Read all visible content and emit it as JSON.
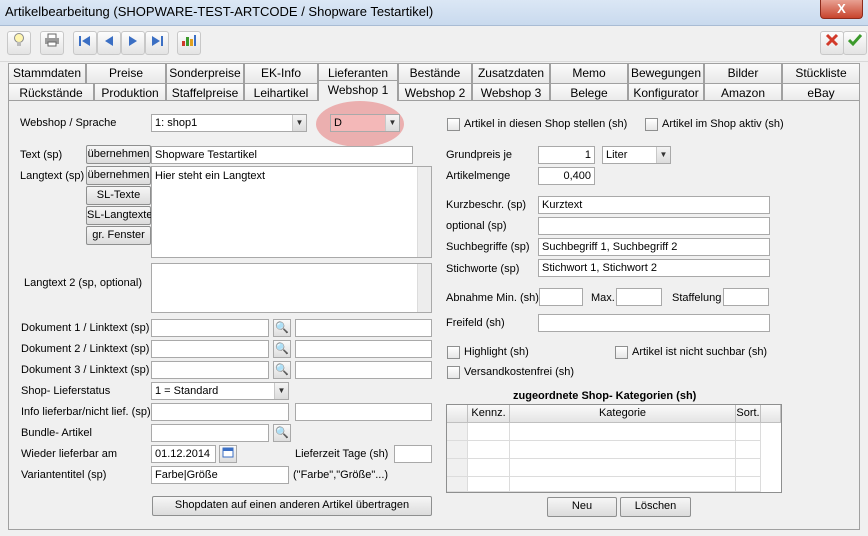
{
  "window": {
    "title": "Artikelbearbeitung (SHOPWARE-TEST-ARTCODE / Shopware Testartikel)",
    "close": "X"
  },
  "toolbar": {
    "icons": [
      "lightbulb-icon",
      "print-icon",
      "first-icon",
      "prev-icon",
      "next-icon",
      "last-icon",
      "chart-icon",
      "cancel-icon",
      "save-check-icon"
    ]
  },
  "tabs_row1": [
    "Stammdaten",
    "Preise",
    "Sonderpreise",
    "EK-Info",
    "Lieferanten",
    "Bestände",
    "Zusatzdaten",
    "Memo",
    "Bewegungen",
    "Bilder",
    "Stückliste"
  ],
  "tabs_row2": [
    "Rückstände",
    "Produktion",
    "Staffelpreise",
    "Leihartikel",
    "Webshop 1",
    "Webshop 2",
    "Webshop 3",
    "Belege",
    "Konfigurator",
    "Amazon",
    "eBay"
  ],
  "active_tab": "Webshop 1",
  "form": {
    "webshop_label": "Webshop / Sprache",
    "webshop_value": "1: shop1",
    "language_value": "D",
    "text_label": "Text (sp)",
    "uebernehmen": "übernehmen",
    "text_value": "Shopware Testartikel",
    "langtext_label": "Langtext (sp)",
    "langtext_value": "Hier steht ein Langtext",
    "sl_texte": "SL-Texte",
    "sl_langtexte": "SL-Langtexte",
    "gr_fenster": "gr. Fenster",
    "langtext2_label": "Langtext 2 (sp, optional)",
    "dok1_label": "Dokument 1 / Linktext (sp)",
    "dok2_label": "Dokument 2 / Linktext (sp)",
    "dok3_label": "Dokument 3 / Linktext (sp)",
    "lieferstatus_label": "Shop- Lieferstatus",
    "lieferstatus_value": "1 = Standard",
    "info_label": "Info lieferbar/nicht lief. (sp)",
    "bundle_label": "Bundle- Artikel",
    "lieferbar_label": "Wieder lieferbar am",
    "lieferbar_value": "01.12.2014",
    "lieferzeit_label": "Lieferzeit Tage (sh)",
    "variantentitel_label": "Variantentitel (sp)",
    "variantentitel_value": "Farbe|Größe",
    "variantentitel_hint": "(\"Farbe\",\"Größe\"...)",
    "shopdaten_button": "Shopdaten auf einen anderen Artikel übertragen"
  },
  "right": {
    "chk_shop_stellen": "Artikel in diesen Shop stellen (sh)",
    "chk_shop_aktiv": "Artikel im Shop aktiv (sh)",
    "grundpreis_label": "Grundpreis je",
    "grundpreis_value": "1",
    "grundpreis_unit": "Liter",
    "artikelmenge_label": "Artikelmenge",
    "artikelmenge_value": "0,400",
    "kurzbeschr_label": "Kurzbeschr. (sp)",
    "kurzbeschr_value": "Kurztext",
    "optional_label": "optional (sp)",
    "suchbegriffe_label": "Suchbegriffe (sp)",
    "suchbegriffe_value": "Suchbegriff 1, Suchbegriff 2",
    "stichworte_label": "Stichworte (sp)",
    "stichworte_value": "Stichwort 1, Stichwort 2",
    "abnahme_label": "Abnahme Min. (sh)",
    "max_label": "Max.",
    "staffelung_label": "Staffelung",
    "freifeld_label": "Freifeld (sh)",
    "chk_highlight": "Highlight (sh)",
    "chk_nicht_suchbar": "Artikel ist nicht suchbar (sh)",
    "chk_versandkostenfrei": "Versandkostenfrei (sh)",
    "kategorien_title": "zugeordnete Shop- Kategorien (sh)",
    "col_kennz": "Kennz.",
    "col_kategorie": "Kategorie",
    "col_sort": "Sort.",
    "neu": "Neu",
    "loeschen": "Löschen"
  },
  "colors": {
    "highlight": "#e87a7a",
    "check_green": "#3c9a2c",
    "cancel_red": "#d23a2a"
  }
}
